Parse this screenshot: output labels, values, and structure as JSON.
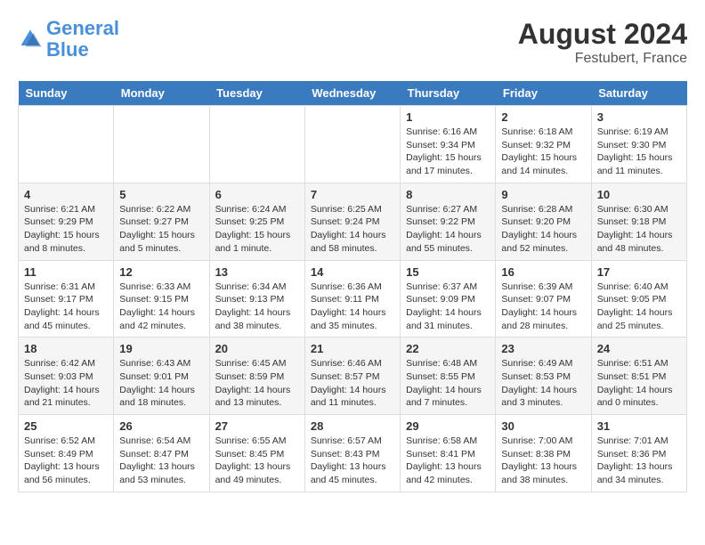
{
  "header": {
    "logo_line1": "General",
    "logo_line2": "Blue",
    "main_title": "August 2024",
    "subtitle": "Festubert, France"
  },
  "days_of_week": [
    "Sunday",
    "Monday",
    "Tuesday",
    "Wednesday",
    "Thursday",
    "Friday",
    "Saturday"
  ],
  "weeks": [
    [
      {
        "day": "",
        "info": ""
      },
      {
        "day": "",
        "info": ""
      },
      {
        "day": "",
        "info": ""
      },
      {
        "day": "",
        "info": ""
      },
      {
        "day": "1",
        "info": "Sunrise: 6:16 AM\nSunset: 9:34 PM\nDaylight: 15 hours and 17 minutes."
      },
      {
        "day": "2",
        "info": "Sunrise: 6:18 AM\nSunset: 9:32 PM\nDaylight: 15 hours and 14 minutes."
      },
      {
        "day": "3",
        "info": "Sunrise: 6:19 AM\nSunset: 9:30 PM\nDaylight: 15 hours and 11 minutes."
      }
    ],
    [
      {
        "day": "4",
        "info": "Sunrise: 6:21 AM\nSunset: 9:29 PM\nDaylight: 15 hours and 8 minutes."
      },
      {
        "day": "5",
        "info": "Sunrise: 6:22 AM\nSunset: 9:27 PM\nDaylight: 15 hours and 5 minutes."
      },
      {
        "day": "6",
        "info": "Sunrise: 6:24 AM\nSunset: 9:25 PM\nDaylight: 15 hours and 1 minute."
      },
      {
        "day": "7",
        "info": "Sunrise: 6:25 AM\nSunset: 9:24 PM\nDaylight: 14 hours and 58 minutes."
      },
      {
        "day": "8",
        "info": "Sunrise: 6:27 AM\nSunset: 9:22 PM\nDaylight: 14 hours and 55 minutes."
      },
      {
        "day": "9",
        "info": "Sunrise: 6:28 AM\nSunset: 9:20 PM\nDaylight: 14 hours and 52 minutes."
      },
      {
        "day": "10",
        "info": "Sunrise: 6:30 AM\nSunset: 9:18 PM\nDaylight: 14 hours and 48 minutes."
      }
    ],
    [
      {
        "day": "11",
        "info": "Sunrise: 6:31 AM\nSunset: 9:17 PM\nDaylight: 14 hours and 45 minutes."
      },
      {
        "day": "12",
        "info": "Sunrise: 6:33 AM\nSunset: 9:15 PM\nDaylight: 14 hours and 42 minutes."
      },
      {
        "day": "13",
        "info": "Sunrise: 6:34 AM\nSunset: 9:13 PM\nDaylight: 14 hours and 38 minutes."
      },
      {
        "day": "14",
        "info": "Sunrise: 6:36 AM\nSunset: 9:11 PM\nDaylight: 14 hours and 35 minutes."
      },
      {
        "day": "15",
        "info": "Sunrise: 6:37 AM\nSunset: 9:09 PM\nDaylight: 14 hours and 31 minutes."
      },
      {
        "day": "16",
        "info": "Sunrise: 6:39 AM\nSunset: 9:07 PM\nDaylight: 14 hours and 28 minutes."
      },
      {
        "day": "17",
        "info": "Sunrise: 6:40 AM\nSunset: 9:05 PM\nDaylight: 14 hours and 25 minutes."
      }
    ],
    [
      {
        "day": "18",
        "info": "Sunrise: 6:42 AM\nSunset: 9:03 PM\nDaylight: 14 hours and 21 minutes."
      },
      {
        "day": "19",
        "info": "Sunrise: 6:43 AM\nSunset: 9:01 PM\nDaylight: 14 hours and 18 minutes."
      },
      {
        "day": "20",
        "info": "Sunrise: 6:45 AM\nSunset: 8:59 PM\nDaylight: 14 hours and 13 minutes."
      },
      {
        "day": "21",
        "info": "Sunrise: 6:46 AM\nSunset: 8:57 PM\nDaylight: 14 hours and 11 minutes."
      },
      {
        "day": "22",
        "info": "Sunrise: 6:48 AM\nSunset: 8:55 PM\nDaylight: 14 hours and 7 minutes."
      },
      {
        "day": "23",
        "info": "Sunrise: 6:49 AM\nSunset: 8:53 PM\nDaylight: 14 hours and 3 minutes."
      },
      {
        "day": "24",
        "info": "Sunrise: 6:51 AM\nSunset: 8:51 PM\nDaylight: 14 hours and 0 minutes."
      }
    ],
    [
      {
        "day": "25",
        "info": "Sunrise: 6:52 AM\nSunset: 8:49 PM\nDaylight: 13 hours and 56 minutes."
      },
      {
        "day": "26",
        "info": "Sunrise: 6:54 AM\nSunset: 8:47 PM\nDaylight: 13 hours and 53 minutes."
      },
      {
        "day": "27",
        "info": "Sunrise: 6:55 AM\nSunset: 8:45 PM\nDaylight: 13 hours and 49 minutes."
      },
      {
        "day": "28",
        "info": "Sunrise: 6:57 AM\nSunset: 8:43 PM\nDaylight: 13 hours and 45 minutes."
      },
      {
        "day": "29",
        "info": "Sunrise: 6:58 AM\nSunset: 8:41 PM\nDaylight: 13 hours and 42 minutes."
      },
      {
        "day": "30",
        "info": "Sunrise: 7:00 AM\nSunset: 8:38 PM\nDaylight: 13 hours and 38 minutes."
      },
      {
        "day": "31",
        "info": "Sunrise: 7:01 AM\nSunset: 8:36 PM\nDaylight: 13 hours and 34 minutes."
      }
    ]
  ]
}
